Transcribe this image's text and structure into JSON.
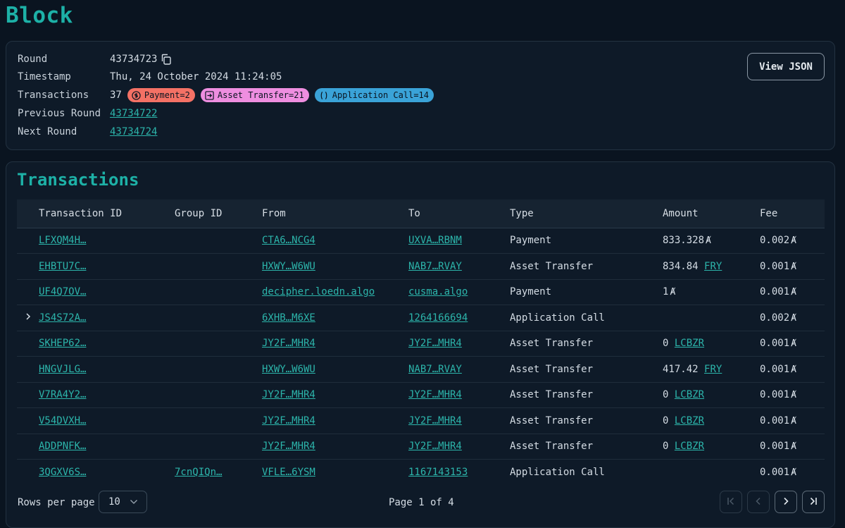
{
  "page_title": "Block",
  "block": {
    "round_label": "Round",
    "round": "43734723",
    "timestamp_label": "Timestamp",
    "timestamp": "Thu, 24 October 2024 11:24:05",
    "transactions_label": "Transactions",
    "transactions_count": "37",
    "badges": {
      "payment": "Payment=2",
      "asset_transfer": "Asset Transfer=21",
      "application_call": "Application Call=14"
    },
    "previous_round_label": "Previous Round",
    "previous_round": "43734722",
    "next_round_label": "Next Round",
    "next_round": "43734724",
    "view_json": "View JSON"
  },
  "transactions": {
    "title": "Transactions",
    "columns": [
      "Transaction ID",
      "Group ID",
      "From",
      "To",
      "Type",
      "Amount",
      "Fee"
    ],
    "rows": [
      {
        "id": "LFXQM4H…",
        "group": "",
        "from": "CTA6…NCG4",
        "to": "UXVA…RBNM",
        "type": "Payment",
        "amount": "833.328",
        "amount_unit": "Ⱥ",
        "amount_asset": "",
        "fee": "0.002",
        "expandable": false
      },
      {
        "id": "EHBTU7C…",
        "group": "",
        "from": "HXWY…W6WU",
        "to": "NAB7…RVAY",
        "type": "Asset Transfer",
        "amount": "834.84",
        "amount_unit": "",
        "amount_asset": "FRY",
        "fee": "0.001",
        "expandable": false
      },
      {
        "id": "UF4Q7OV…",
        "group": "",
        "from": "decipher.loedn.algo",
        "to": "cusma.algo",
        "type": "Payment",
        "amount": "1",
        "amount_unit": "Ⱥ",
        "amount_asset": "",
        "fee": "0.001",
        "expandable": false
      },
      {
        "id": "JS4S72A…",
        "group": "",
        "from": "6XHB…M6XE",
        "to": "1264166694",
        "type": "Application Call",
        "amount": "",
        "amount_unit": "",
        "amount_asset": "",
        "fee": "0.002",
        "expandable": true
      },
      {
        "id": "SKHEP62…",
        "group": "",
        "from": "JY2F…MHR4",
        "to": "JY2F…MHR4",
        "type": "Asset Transfer",
        "amount": "0",
        "amount_unit": "",
        "amount_asset": "LCBZR",
        "fee": "0.001",
        "expandable": false
      },
      {
        "id": "HNGVJLG…",
        "group": "",
        "from": "HXWY…W6WU",
        "to": "NAB7…RVAY",
        "type": "Asset Transfer",
        "amount": "417.42",
        "amount_unit": "",
        "amount_asset": "FRY",
        "fee": "0.001",
        "expandable": false
      },
      {
        "id": "V7RA4Y2…",
        "group": "",
        "from": "JY2F…MHR4",
        "to": "JY2F…MHR4",
        "type": "Asset Transfer",
        "amount": "0",
        "amount_unit": "",
        "amount_asset": "LCBZR",
        "fee": "0.001",
        "expandable": false
      },
      {
        "id": "V54DVXH…",
        "group": "",
        "from": "JY2F…MHR4",
        "to": "JY2F…MHR4",
        "type": "Asset Transfer",
        "amount": "0",
        "amount_unit": "",
        "amount_asset": "LCBZR",
        "fee": "0.001",
        "expandable": false
      },
      {
        "id": "ADDPNFK…",
        "group": "",
        "from": "JY2F…MHR4",
        "to": "JY2F…MHR4",
        "type": "Asset Transfer",
        "amount": "0",
        "amount_unit": "",
        "amount_asset": "LCBZR",
        "fee": "0.001",
        "expandable": false
      },
      {
        "id": "3QGXV6S…",
        "group": "7cnQIQn…",
        "from": "VFLE…6YSM",
        "to": "1167143153",
        "type": "Application Call",
        "amount": "",
        "amount_unit": "",
        "amount_asset": "",
        "fee": "0.001",
        "expandable": false
      }
    ],
    "fee_unit": "Ⱥ",
    "footer": {
      "rows_per_page_label": "Rows per page",
      "rows_per_page": "10",
      "page_info": "Page 1 of 4"
    }
  },
  "icons": {
    "copy": "copy-icon",
    "payment": "dollar-circle-icon",
    "asset_transfer": "arrow-box-icon",
    "application_call": "parentheses-icon",
    "expand": "chevron-right-icon",
    "first_page": "first-page-icon",
    "prev_page": "prev-page-icon",
    "next_page": "next-page-icon",
    "last_page": "last-page-icon"
  },
  "colors": {
    "accent": "#1db1a7",
    "link": "#2cb5ab",
    "payment_badge": "#f47165",
    "asset_badge": "#ee8ee0",
    "app_badge": "#3aa3d8",
    "background": "#0a1420"
  }
}
